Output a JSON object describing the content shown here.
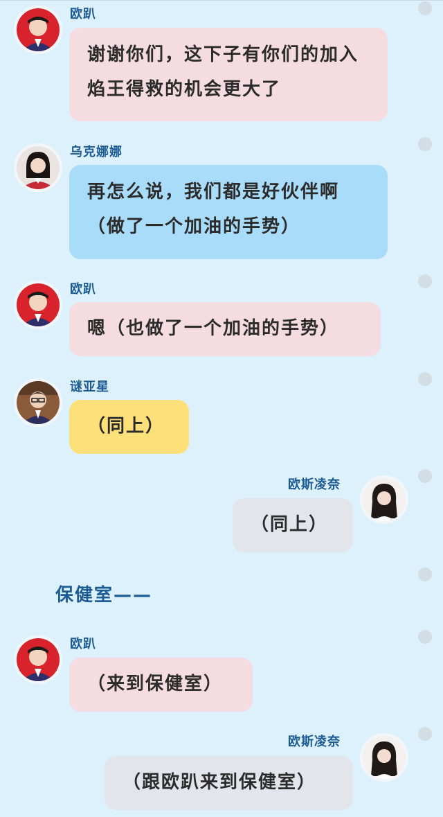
{
  "messages": [
    {
      "sender": "欧趴",
      "text": "谢谢你们，这下子有你们的加入焰王得救的机会更大了",
      "bubble_color": "#f4dce0",
      "side": "left",
      "avatar": "boy-red-bg-avatar"
    },
    {
      "sender": "乌克娜娜",
      "text": "再怎么说，我们都是好伙伴啊（做了一个加油的手势）",
      "bubble_color": "#a9dcf8",
      "side": "left",
      "avatar": "girl-red-uniform-avatar"
    },
    {
      "sender": "欧趴",
      "text": "嗯（也做了一个加油的手势）",
      "bubble_color": "#f4dce0",
      "side": "left",
      "avatar": "boy-red-bg-avatar"
    },
    {
      "sender": "谜亚星",
      "text": "（同上）",
      "bubble_color": "#fde07a",
      "side": "left",
      "avatar": "boy-glasses-avatar"
    },
    {
      "sender": "欧斯凌奈",
      "text": "（同上）",
      "bubble_color": "#e2e6ec",
      "side": "right",
      "avatar": "girl-dark-hair-avatar"
    },
    {
      "sender": "欧趴",
      "text": "（来到保健室）",
      "bubble_color": "#f4dce0",
      "side": "left",
      "avatar": "boy-red-bg-avatar"
    },
    {
      "sender": "欧斯凌奈",
      "text": "（跟欧趴来到保健室）",
      "bubble_color": "#e2e6ec",
      "side": "right",
      "avatar": "girl-dark-hair-avatar"
    }
  ],
  "section": {
    "title": "保健室——"
  },
  "colors": {
    "background": "#ddf1fc",
    "name_text": "#1d5b93",
    "dot": "#d3dde4"
  }
}
